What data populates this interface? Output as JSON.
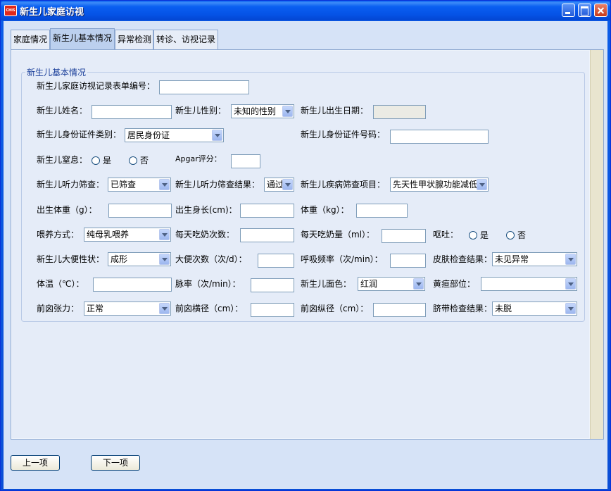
{
  "window": {
    "title": "新生儿家庭访视",
    "icon_text": "CHIS"
  },
  "tabs": [
    {
      "label": "家庭情况"
    },
    {
      "label": "新生儿基本情况"
    },
    {
      "label": "异常检测"
    },
    {
      "label": "转诊、访视记录"
    }
  ],
  "group_title": "新生儿基本情况",
  "form": {
    "record_no_label": "新生儿家庭访视记录表单编号：",
    "name_label": "新生儿姓名：",
    "sex_label": "新生儿性别：",
    "sex_value": "未知的性别",
    "birthdate_label": "新生儿出生日期：",
    "id_type_label": "新生儿身份证件类别：",
    "id_type_value": "居民身份证",
    "id_no_label": "新生儿身份证件号码：",
    "asphyxia_label": "新生儿窒息：",
    "yes": "是",
    "no": "否",
    "apgar_label": "Apgar评分：",
    "hearing_label": "新生儿听力筛查：",
    "hearing_value": "已筛查",
    "hearing_result_label": "新生儿听力筛查结果：",
    "hearing_result_value": "通过",
    "disease_screen_label": "新生儿疾病筛查项目：",
    "disease_screen_value": "先天性甲状腺功能减低",
    "birth_weight_label": "出生体重（g）：",
    "birth_length_label": "出生身长(cm)：",
    "weight_label": "体重（kg）：",
    "feeding_label": "喂养方式：",
    "feeding_value": "纯母乳喂养",
    "feeds_per_day_label": "每天吃奶次数：",
    "milk_per_day_label": "每天吃奶量（ml）：",
    "vomit_label": "呕吐：",
    "stool_label": "新生儿大便性状：",
    "stool_value": "成形",
    "stool_times_label": "大便次数（次/d）：",
    "resp_label": "呼吸频率（次/min）：",
    "skin_label": "皮肤检查结果：",
    "skin_value": "未见异常",
    "temp_label": "体温（℃）：",
    "pulse_label": "脉率（次/min）：",
    "complexion_label": "新生儿面色：",
    "complexion_value": "红润",
    "jaundice_label": "黄疸部位：",
    "jaundice_value": "",
    "fontanel_tension_label": "前囟张力：",
    "fontanel_tension_value": "正常",
    "fontanel_h_label": "前囟横径（cm）：",
    "fontanel_v_label": "前囟纵径（cm）：",
    "umbilical_label": "脐带检查结果：",
    "umbilical_value": "未脱"
  },
  "buttons": {
    "prev": "上一项",
    "next": "下一项"
  }
}
